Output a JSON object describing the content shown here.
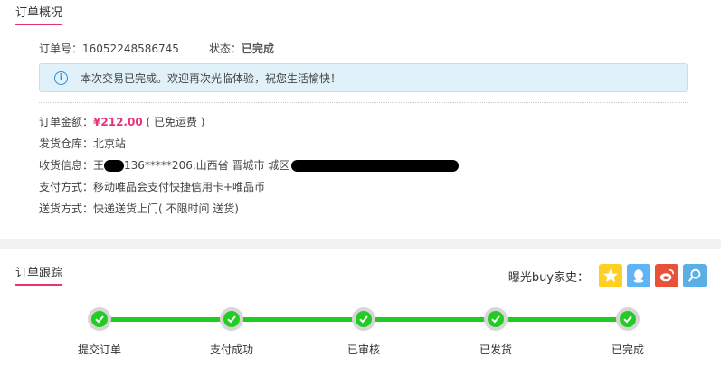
{
  "overview": {
    "title": "订单概况",
    "order_no_label": "订单号：",
    "order_no": "16052248586745",
    "status_label": "状态：",
    "status_value": "已完成",
    "notice": "本次交易已完成。欢迎再次光临体验，祝您生活愉快！",
    "amount_label": "订单金额：",
    "amount": "¥212.00",
    "amount_note": "( 已免运费 )",
    "warehouse": "发货仓库：北京站",
    "receiver_label": "收货信息：",
    "receiver_name": "王",
    "receiver_phone": "136*****206,山西省 晋城市 城区",
    "payment": "支付方式：移动唯品会支付快捷信用卡+唯品币",
    "delivery": "送货方式：快递送货上门( 不限时间 送货)"
  },
  "tracking": {
    "title": "订单跟踪",
    "share_label": "曝光buy家史：",
    "share_icons": [
      "star-icon",
      "qq-icon",
      "weibo-icon",
      "search-icon"
    ],
    "steps": [
      "提交订单",
      "支付成功",
      "已审核",
      "已发货",
      "已完成"
    ]
  },
  "colors": {
    "accent": "#e8337a",
    "progress": "#22cc22",
    "notice_bg": "#e1f1fa"
  }
}
